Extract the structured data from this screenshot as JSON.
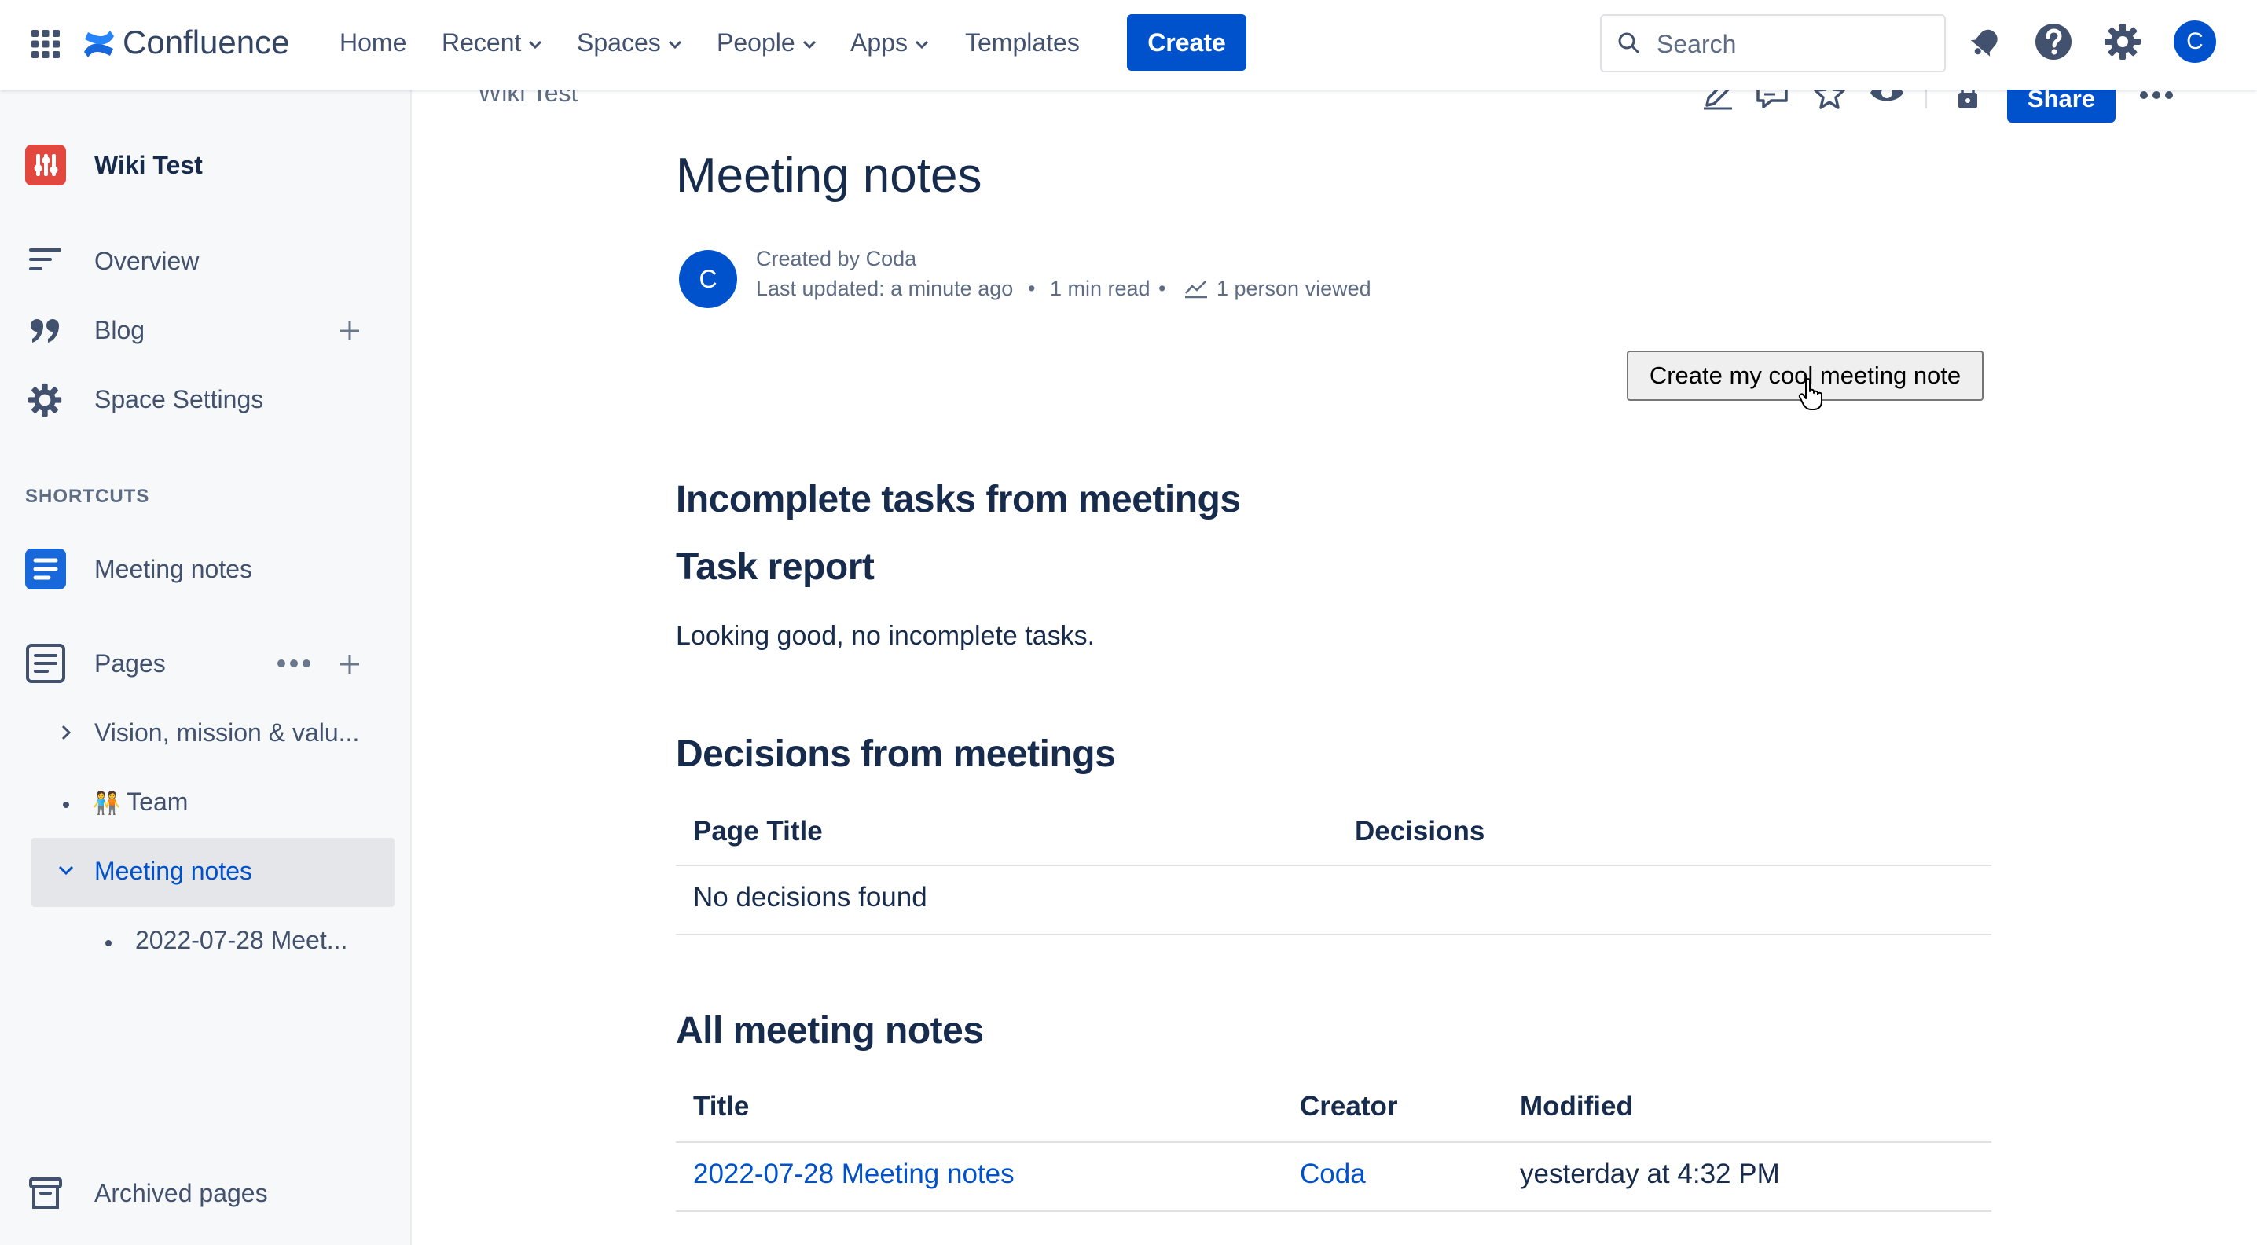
{
  "colors": {
    "brand": "#0052cc",
    "text": "#172b4d",
    "subtle": "#42526e",
    "space_icon": "#e2483d"
  },
  "topnav": {
    "logo_text": "Confluence",
    "items": [
      "Home",
      "Recent",
      "Spaces",
      "People",
      "Apps",
      "Templates"
    ],
    "create_label": "Create",
    "search_placeholder": "Search",
    "avatar_letter": "C"
  },
  "sidebar": {
    "space_name": "Wiki Test",
    "overview": "Overview",
    "blog": "Blog",
    "space_settings": "Space Settings",
    "shortcuts_heading": "SHORTCUTS",
    "shortcut_meeting_notes": "Meeting notes",
    "pages": "Pages",
    "tree": {
      "vision": "Vision, mission & valu...",
      "team_emoji": "🧑‍🤝‍🧑",
      "team": "Team",
      "meeting_notes": "Meeting notes",
      "child": "2022-07-28 Meet..."
    },
    "archived": "Archived pages"
  },
  "page": {
    "breadcrumb": "Wiki Test",
    "share_label": "Share",
    "title": "Meeting notes",
    "author_avatar": "C",
    "created_by": "Created by Coda",
    "last_updated": "Last updated: a minute ago",
    "read_time": "1 min read",
    "viewed": "1 person viewed",
    "button_label": "Create my cool meeting note",
    "incomplete_heading": "Incomplete tasks from meetings",
    "task_report_heading": "Task report",
    "task_report_text": "Looking good, no incomplete tasks.",
    "decisions_heading": "Decisions from meetings",
    "decisions_table": {
      "headers": [
        "Page Title",
        "Decisions"
      ],
      "empty": "No decisions found"
    },
    "all_notes_heading": "All meeting notes",
    "notes_table": {
      "headers": [
        "Title",
        "Creator",
        "Modified"
      ],
      "rows": [
        {
          "title": "2022-07-28 Meeting notes",
          "creator": "Coda",
          "modified": "yesterday at 4:32 PM"
        }
      ]
    }
  }
}
